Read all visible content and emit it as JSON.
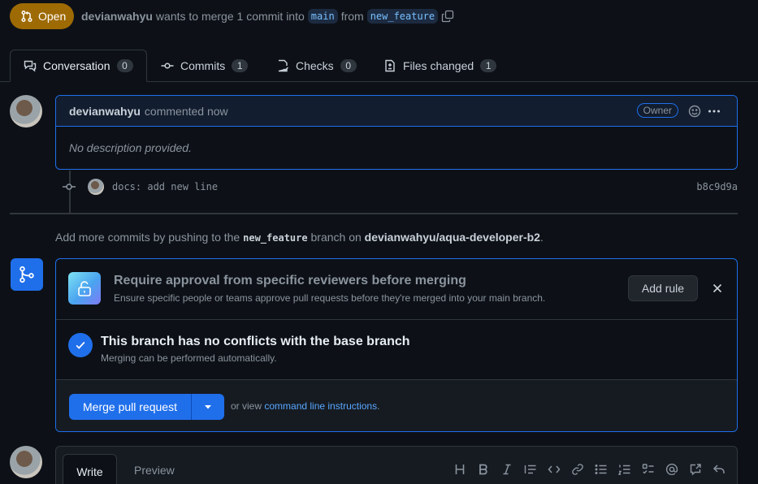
{
  "header": {
    "state": "Open",
    "author": "devianwahyu",
    "text_merge": "wants to merge 1 commit into",
    "base_branch": "main",
    "text_from": "from",
    "head_branch": "new_feature"
  },
  "tabs": [
    {
      "label": "Conversation",
      "count": "0"
    },
    {
      "label": "Commits",
      "count": "1"
    },
    {
      "label": "Checks",
      "count": "0"
    },
    {
      "label": "Files changed",
      "count": "1"
    }
  ],
  "comment": {
    "author": "devianwahyu",
    "time": "commented now",
    "badge": "Owner",
    "body": "No description provided."
  },
  "commit": {
    "message": "docs: add new line",
    "sha": "b8c9d9a"
  },
  "push_hint": {
    "prefix": "Add more commits by pushing to the",
    "branch": "new_feature",
    "middle": "branch on",
    "repo": "devianwahyu/aqua-developer-b2",
    "suffix": "."
  },
  "rule_prompt": {
    "title": "Require approval from specific reviewers before merging",
    "description": "Ensure specific people or teams approve pull requests before they're merged into your main branch.",
    "button": "Add rule"
  },
  "conflicts": {
    "title": "This branch has no conflicts with the base branch",
    "description": "Merging can be performed automatically."
  },
  "merge": {
    "button": "Merge pull request",
    "or_view": "or view",
    "link": "command line instructions",
    "link_suffix": "."
  },
  "composer": {
    "write": "Write",
    "preview": "Preview"
  },
  "colors": {
    "accent": "#1f6feb",
    "open_badge": "#9e6a03",
    "background": "#0d1117"
  }
}
